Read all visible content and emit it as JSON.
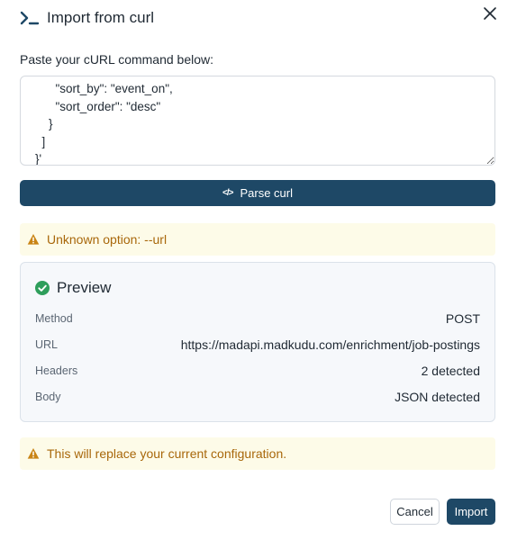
{
  "dialog": {
    "title": "Import from curl",
    "title_icon": "terminal-icon",
    "close_icon": "close-icon"
  },
  "input": {
    "label": "Paste your cURL command below:",
    "value": "      \"sort_by\": \"event_on\",\n      \"sort_order\": \"desc\"\n    }\n  ]\n}'"
  },
  "parse_button": {
    "icon": "code-icon",
    "label": "Parse curl"
  },
  "warning_unknown": {
    "icon": "warning-icon",
    "text": "Unknown option: --url"
  },
  "preview": {
    "icon": "check-circle-icon",
    "title": "Preview",
    "rows": [
      {
        "key": "Method",
        "value": "POST"
      },
      {
        "key": "URL",
        "value": "https://madapi.madkudu.com/enrichment/job-postings"
      },
      {
        "key": "Headers",
        "value": "2 detected"
      },
      {
        "key": "Body",
        "value": "JSON detected"
      }
    ]
  },
  "warning_replace": {
    "icon": "warning-icon",
    "text": "This will replace your current configuration."
  },
  "footer": {
    "cancel_label": "Cancel",
    "import_label": "Import"
  },
  "colors": {
    "primary": "#1e4866",
    "warning_bg": "#fdfbe8",
    "warning_text": "#a8670a",
    "success": "#2e9e5b"
  }
}
